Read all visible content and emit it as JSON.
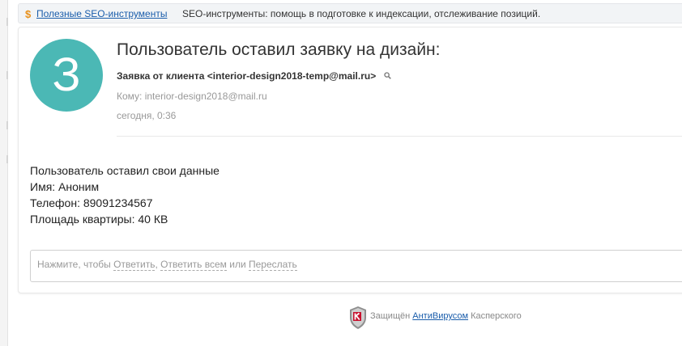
{
  "ad": {
    "dollar_icon": "$",
    "link_text": "Полезные SEO-инструменты",
    "text": "SEO-инструменты: помощь в подготовке к индексации, отслеживание позиций."
  },
  "message": {
    "avatar_letter": "З",
    "avatar_color": "#4bb8b5",
    "subject": "Пользователь оставил заявку на дизайн:",
    "from": "Заявка от клиента <interior-design2018-temp@mail.ru>",
    "to": "Кому: interior-design2018@mail.ru",
    "date": "сегодня, 0:36",
    "body_lines": [
      "Пользователь оставил свои данные",
      "Имя: Аноним",
      "Телефон: 89091234567",
      "Площадь квартиры: 40 КВ"
    ]
  },
  "reply": {
    "prefix": "Нажмите, чтобы ",
    "reply_label": "Ответить",
    "sep1": ", ",
    "reply_all_label": "Ответить всем",
    "sep2": " или ",
    "forward_label": "Переслать"
  },
  "footer": {
    "prefix": "Защищён ",
    "link_text": "АнтиВирусом",
    "suffix": " Касперского"
  }
}
